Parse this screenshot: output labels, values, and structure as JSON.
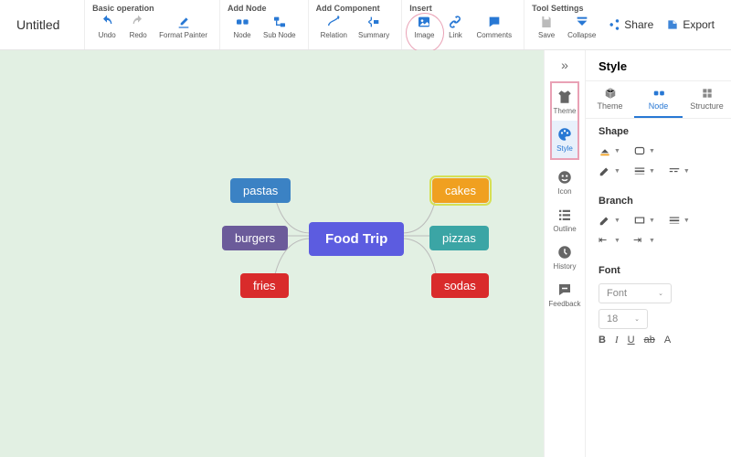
{
  "doc_title": "Untitled",
  "toolbar": {
    "groups": [
      {
        "label": "Basic operation",
        "items": [
          {
            "id": "undo",
            "label": "Undo",
            "icon": "undo-icon",
            "color": "#2878d4"
          },
          {
            "id": "redo",
            "label": "Redo",
            "icon": "redo-icon",
            "color": "#bbb"
          },
          {
            "id": "format-painter",
            "label": "Format Painter",
            "icon": "brush-icon",
            "color": "#2878d4"
          }
        ]
      },
      {
        "label": "Add Node",
        "items": [
          {
            "id": "node",
            "label": "Node",
            "icon": "node-icon",
            "color": "#2878d4"
          },
          {
            "id": "sub-node",
            "label": "Sub Node",
            "icon": "subnode-icon",
            "color": "#2878d4"
          }
        ]
      },
      {
        "label": "Add Component",
        "items": [
          {
            "id": "relation",
            "label": "Relation",
            "icon": "relation-icon",
            "color": "#2878d4"
          },
          {
            "id": "summary",
            "label": "Summary",
            "icon": "summary-icon",
            "color": "#2878d4"
          }
        ]
      },
      {
        "label": "Insert",
        "items": [
          {
            "id": "image",
            "label": "Image",
            "icon": "image-icon",
            "color": "#2878d4",
            "circled": true
          },
          {
            "id": "link",
            "label": "Link",
            "icon": "link-icon",
            "color": "#2878d4"
          },
          {
            "id": "comments",
            "label": "Comments",
            "icon": "comments-icon",
            "color": "#2878d4"
          }
        ]
      },
      {
        "label": "Tool Settings",
        "items": [
          {
            "id": "save",
            "label": "Save",
            "icon": "save-icon",
            "color": "#bbb"
          },
          {
            "id": "collapse",
            "label": "Collapse",
            "icon": "collapse-icon",
            "color": "#2878d4"
          }
        ]
      }
    ],
    "actions": {
      "share": "Share",
      "export": "Export"
    }
  },
  "mindmap": {
    "center": "Food Trip",
    "left": [
      "pastas",
      "burgers",
      "fries"
    ],
    "right": [
      "cakes",
      "pizzas",
      "sodas"
    ]
  },
  "sidebar": {
    "items": [
      {
        "id": "theme",
        "label": "Theme",
        "icon": "shirt-icon"
      },
      {
        "id": "style",
        "label": "Style",
        "icon": "palette-icon",
        "active": true
      },
      {
        "id": "icon",
        "label": "Icon",
        "icon": "smile-icon"
      },
      {
        "id": "outline",
        "label": "Outline",
        "icon": "list-icon"
      },
      {
        "id": "history",
        "label": "History",
        "icon": "clock-icon"
      },
      {
        "id": "feedback",
        "label": "Feedback",
        "icon": "feedback-icon"
      }
    ]
  },
  "panel": {
    "title": "Style",
    "tabs": [
      {
        "id": "theme",
        "label": "Theme"
      },
      {
        "id": "node",
        "label": "Node",
        "active": true
      },
      {
        "id": "structure",
        "label": "Structure"
      }
    ],
    "sections": {
      "shape": "Shape",
      "branch": "Branch",
      "font": "Font"
    },
    "font_family": "Font",
    "font_size": "18",
    "formats": [
      "B",
      "I",
      "U",
      "ab",
      "A"
    ]
  }
}
